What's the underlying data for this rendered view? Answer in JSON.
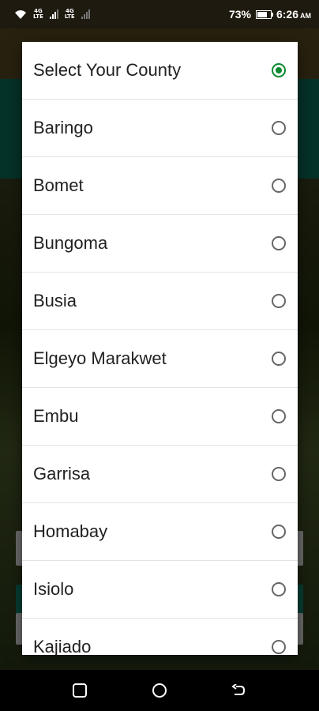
{
  "status_bar": {
    "network_1": "4G\nLTE",
    "network_2": "4G\nLTE",
    "battery_percent": "73%",
    "battery_level": 0.73,
    "time": "6:26",
    "ampm": "AM"
  },
  "dialog": {
    "options": [
      {
        "label": "Select Your County",
        "selected": true
      },
      {
        "label": "Baringo",
        "selected": false
      },
      {
        "label": "Bomet",
        "selected": false
      },
      {
        "label": "Bungoma",
        "selected": false
      },
      {
        "label": "Busia",
        "selected": false
      },
      {
        "label": "Elgeyo Marakwet",
        "selected": false
      },
      {
        "label": "Embu",
        "selected": false
      },
      {
        "label": "Garrisa",
        "selected": false
      },
      {
        "label": "Homabay",
        "selected": false
      },
      {
        "label": "Isiolo",
        "selected": false
      },
      {
        "label": "Kajiado",
        "selected": false
      }
    ]
  },
  "colors": {
    "accent_green": "#0a8a2f",
    "teal_header": "#0d6f5c",
    "toolbar_brown": "#5a4a22"
  },
  "nav_icons": [
    "recent-apps-icon",
    "home-icon",
    "back-icon"
  ]
}
